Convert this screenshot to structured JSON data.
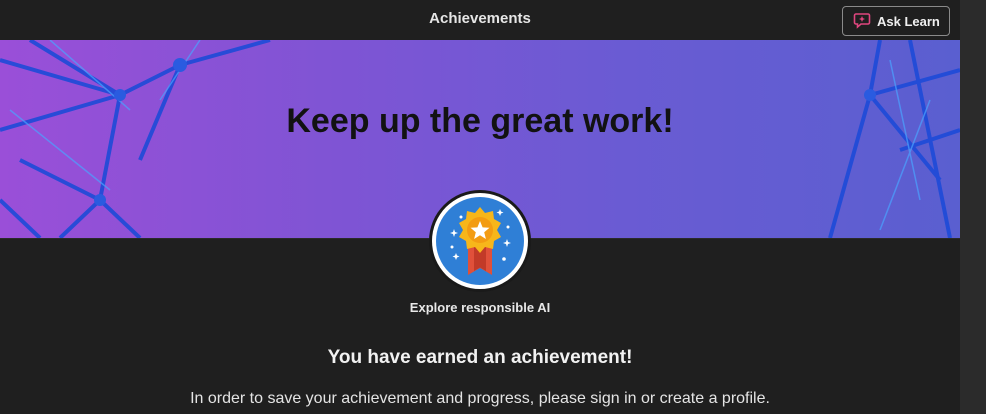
{
  "header": {
    "title": "Achievements",
    "ask_learn_label": "Ask Learn"
  },
  "banner": {
    "heading": "Keep up the great work!"
  },
  "badge": {
    "name": "Explore responsible AI"
  },
  "message": {
    "earned": "You have earned an achievement!",
    "signin_prompt": "In order to save your achievement and progress, please sign in or create a profile."
  },
  "colors": {
    "background": "#1f1f1f",
    "banner_start": "#9a4fd8",
    "banner_end": "#5a5fd0",
    "badge_blue": "#2f7fd6",
    "medal_gold": "#f7b61a",
    "ribbon_red": "#e0503a",
    "ask_icon_pink": "#e0467f"
  },
  "icons": {
    "ask_learn": "sparkle-chat-icon",
    "badge": "award-medal-icon"
  }
}
